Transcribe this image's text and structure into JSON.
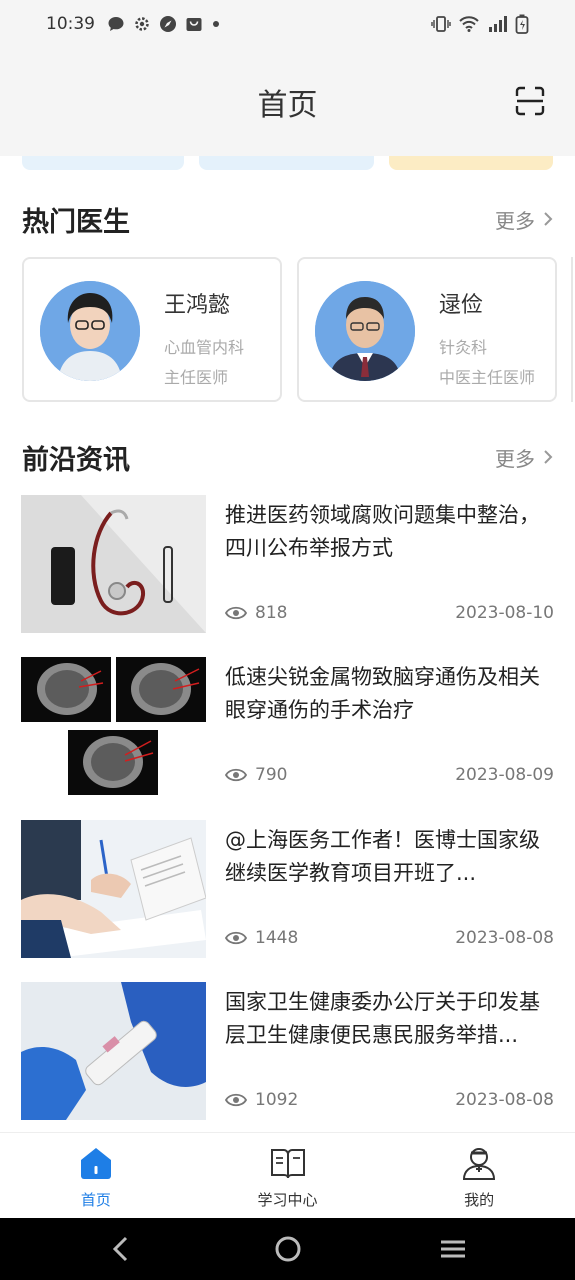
{
  "status_bar": {
    "time": "10:39",
    "left_icons": [
      "message-icon",
      "gear-icon",
      "compass-icon",
      "bag-icon",
      "dot-icon"
    ],
    "right_icons": [
      "vibrate-icon",
      "wifi-icon",
      "signal-icon",
      "battery-icon"
    ]
  },
  "header": {
    "title": "首页",
    "scan_icon": "scan-icon"
  },
  "hot_doctors": {
    "title": "热门医生",
    "more": "更多",
    "items": [
      {
        "name": "王鸿懿",
        "department": "心血管内科",
        "title": "主任医师"
      },
      {
        "name": "逯俭",
        "department": "针灸科",
        "title": "中医主任医师"
      }
    ]
  },
  "news": {
    "title": "前沿资讯",
    "more": "更多",
    "items": [
      {
        "title": "推进医药领域腐败问题集中整治，四川公布举报方式",
        "views": "818",
        "date": "2023-08-10",
        "thumb": "stethoscope-phone-photo"
      },
      {
        "title": "低速尖锐金属物致脑穿通伤及相关眼穿通伤的手术治疗",
        "views": "790",
        "date": "2023-08-09",
        "thumb": "brain-ct-scans"
      },
      {
        "title": "@上海医务工作者！医博士国家级继续医学教育项目开班了...",
        "views": "1448",
        "date": "2023-08-08",
        "thumb": "document-signing-photo"
      },
      {
        "title": "国家卫生健康委办公厅关于印发基层卫生健康便民惠民服务举措...",
        "views": "1092",
        "date": "2023-08-08",
        "thumb": "test-kit-gloves-photo"
      }
    ]
  },
  "tabs": [
    {
      "label": "首页",
      "icon": "home-icon",
      "active": true
    },
    {
      "label": "学习中心",
      "icon": "book-icon",
      "active": false
    },
    {
      "label": "我的",
      "icon": "doctor-profile-icon",
      "active": false
    }
  ],
  "colors": {
    "accent": "#1e7ee6",
    "avatar_bg": "#6fa7e6",
    "header_bg": "#f5f5f5"
  }
}
